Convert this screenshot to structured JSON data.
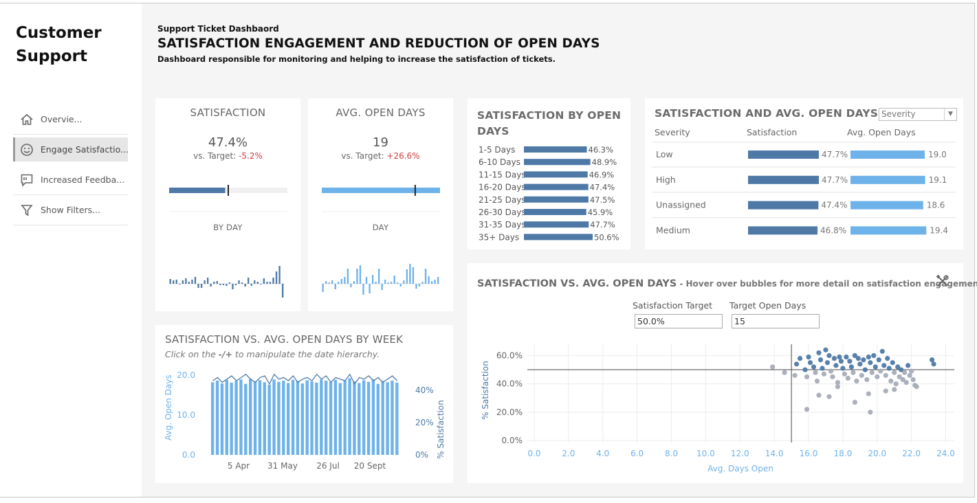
{
  "brand": {
    "line1": "Customer",
    "line2": "Support"
  },
  "nav": [
    {
      "label": "Overvie...",
      "icon": "home-icon"
    },
    {
      "label": "Engage Satisfactio...",
      "icon": "smiley-icon"
    },
    {
      "label": "Increased Feedba...",
      "icon": "feedback-icon"
    },
    {
      "label": "Show Filters...",
      "icon": "filter-icon"
    }
  ],
  "header": {
    "small": "Support Ticket Dashbaord",
    "title": "SATISFACTION ENGAGEMENT AND REDUCTION OF OPEN DAYS",
    "subtitle": "Dashboard responsible for monitoring and helping to increase the satisfaction of tickets."
  },
  "kpi_satisfaction": {
    "title": "SATISFACTION",
    "value": "47.4%",
    "vs_prefix": "vs. Target: ",
    "vs_value": "-5.2%",
    "sub": "BY DAY",
    "bar_fill": 0.474,
    "target_mark": 0.5
  },
  "kpi_open_days": {
    "title": "AVG. OPEN DAYS",
    "value": "19",
    "vs_prefix": "vs. Target: ",
    "vs_value": "+26.6%",
    "sub": "DAY",
    "bar_fill": 1.0,
    "target_mark": 0.79
  },
  "spark_satisfaction": [
    7,
    5,
    6,
    -1,
    5,
    8,
    3,
    6,
    10,
    -6,
    -6,
    5,
    9,
    -4,
    3,
    4,
    -2,
    -2,
    -3,
    2,
    -8,
    -2,
    5,
    2,
    -4,
    9,
    -3,
    5,
    3,
    -1,
    8,
    3,
    3,
    9,
    18,
    26,
    -20
  ],
  "spark_open_days": [
    -12,
    4,
    2,
    5,
    -8,
    3,
    7,
    10,
    22,
    -5,
    4,
    22,
    27,
    -16,
    10,
    -14,
    13,
    3,
    22,
    -9,
    6,
    2,
    3,
    12,
    2,
    -4,
    5,
    21,
    29,
    24,
    -7,
    -4,
    3,
    22,
    11,
    4,
    6,
    10
  ],
  "sat_by_open_days": {
    "title_line1": "SATISFACTION BY OPEN",
    "title_line2": "DAYS",
    "rows": [
      {
        "label": "1-5 Days",
        "value": 46.3,
        "text": "46.3%"
      },
      {
        "label": "6-10 Days",
        "value": 48.9,
        "text": "48.9%"
      },
      {
        "label": "11-15 Days",
        "value": 46.9,
        "text": "46.9%"
      },
      {
        "label": "16-20 Days",
        "value": 47.4,
        "text": "47.4%"
      },
      {
        "label": "21-25 Days",
        "value": 47.5,
        "text": "47.5%"
      },
      {
        "label": "26-30 Days",
        "value": 45.9,
        "text": "45.9%"
      },
      {
        "label": "31-35 Days",
        "value": 47.7,
        "text": "47.7%"
      },
      {
        "label": "35+ Days",
        "value": 50.6,
        "text": "50.6%"
      }
    ]
  },
  "severity": {
    "title": "SATISFACTION AND AVG. OPEN DAYS BY",
    "select_value": "Severity",
    "col_severity": "Severity",
    "col_satisfaction": "Satisfaction",
    "col_open_days": "Avg. Open Days",
    "rows": [
      {
        "label": "Low",
        "sat": 47.7,
        "sat_text": "47.7%",
        "days": 19.0,
        "days_text": "19.0"
      },
      {
        "label": "High",
        "sat": 47.7,
        "sat_text": "47.7%",
        "days": 19.1,
        "days_text": "19.1"
      },
      {
        "label": "Unassigned",
        "sat": 47.4,
        "sat_text": "47.4%",
        "days": 18.6,
        "days_text": "18.6"
      },
      {
        "label": "Medium",
        "sat": 46.8,
        "sat_text": "46.8%",
        "days": 19.4,
        "days_text": "19.4"
      }
    ]
  },
  "weekly": {
    "title": "SATISFACTION VS. AVG. OPEN DAYS BY WEEK",
    "hint_pre": "Click on the ",
    "hint_symbol": "-/+",
    "hint_post": " to manipulate the date hierarchy.",
    "y_left_label": "Avg. Open Days",
    "y_right_label": "% Satisfaction",
    "y_left_ticks": [
      "20.0",
      "10.0",
      "0.0"
    ],
    "y_right_ticks": [
      "40%",
      "20%",
      "0%"
    ],
    "x_ticks": [
      "5 Apr",
      "31 May",
      "26 Jul",
      "20 Sept"
    ]
  },
  "scatter": {
    "title": "SATISFACTION VS. AVG. OPEN DAYS",
    "title_note": " - Hover over bubbles for more detail on satisfaction engagement.",
    "param_sat_label": "Satisfaction Target",
    "param_sat_value": "50.0%",
    "param_days_label": "Target Open Days",
    "param_days_value": "15",
    "y_label": "% Satisfaction",
    "x_label": "Avg. Days Open",
    "y_ticks": [
      "60.0%",
      "40.0%",
      "20.0%",
      "0.0%"
    ],
    "x_ticks": [
      "0.0",
      "2.0",
      "4.0",
      "6.0",
      "8.0",
      "10.0",
      "12.0",
      "14.0",
      "16.0",
      "18.0",
      "20.0",
      "22.0",
      "24.0"
    ],
    "target_sat": 50,
    "target_days": 15
  },
  "colors": {
    "dark_blue": "#4e79a7",
    "light_blue": "#6eb2ea",
    "grey_dot": "#a7acb8",
    "negative": "#d23b3b"
  },
  "chart_data": [
    {
      "type": "bar",
      "title": "SATISFACTION BY OPEN DAYS",
      "categories": [
        "1-5 Days",
        "6-10 Days",
        "11-15 Days",
        "16-20 Days",
        "21-25 Days",
        "26-30 Days",
        "31-35 Days",
        "35+ Days"
      ],
      "values": [
        46.3,
        48.9,
        46.9,
        47.4,
        47.5,
        45.9,
        47.7,
        50.6
      ]
    },
    {
      "type": "bar",
      "title": "SATISFACTION AND AVG. OPEN DAYS BY",
      "categories": [
        "Low",
        "High",
        "Unassigned",
        "Medium"
      ],
      "series": [
        {
          "name": "Satisfaction",
          "values": [
            47.7,
            47.7,
            47.4,
            46.8
          ]
        },
        {
          "name": "Avg. Open Days",
          "values": [
            19.0,
            19.1,
            18.6,
            19.4
          ]
        }
      ]
    },
    {
      "type": "bar",
      "title": "SATISFACTION VS. AVG. OPEN DAYS BY WEEK",
      "xlabel": "",
      "ylabel": "Avg. Open Days",
      "ylim": [
        0,
        21
      ],
      "x_ticks": [
        "5 Apr",
        "31 May",
        "26 Jul",
        "20 Sept"
      ],
      "series": [
        {
          "name": "Avg. Open Days",
          "values": [
            18.2,
            18.6,
            17.9,
            18.8,
            18.1,
            18.5,
            18.9,
            17.8,
            19.0,
            18.4,
            18.7,
            18.2,
            17.6,
            18.9,
            18.3,
            18.6,
            18.0,
            18.8,
            18.5,
            17.9,
            18.7,
            18.4,
            18.1,
            18.9,
            18.6,
            18.2,
            18.8,
            18.0,
            18.6,
            19.2,
            18.4,
            18.0,
            18.7,
            18.3,
            18.9,
            17.8,
            18.5,
            18.2,
            18.6,
            18.1
          ]
        },
        {
          "name": "% Satisfaction",
          "values": [
            46,
            48,
            45,
            47,
            49,
            46,
            48,
            50,
            47,
            45,
            48,
            49,
            44,
            50,
            47,
            48,
            46,
            49,
            45,
            47,
            48,
            46,
            50,
            47,
            49,
            45,
            48,
            47,
            46,
            50,
            44,
            48,
            47,
            49,
            46,
            48,
            45,
            47,
            49,
            46
          ]
        }
      ]
    },
    {
      "type": "scatter",
      "title": "SATISFACTION VS. AVG. OPEN DAYS",
      "xlabel": "Avg. Days Open",
      "ylabel": "% Satisfaction",
      "xlim": [
        0,
        24.5
      ],
      "ylim": [
        0,
        68
      ],
      "reference_lines": {
        "x": 15,
        "y": 50
      },
      "points": [
        [
          13.9,
          52
        ],
        [
          14.6,
          48
        ],
        [
          15.3,
          54
        ],
        [
          15.2,
          46
        ],
        [
          15.5,
          58
        ],
        [
          15.8,
          50
        ],
        [
          15.9,
          45
        ],
        [
          16.0,
          59
        ],
        [
          16.1,
          55
        ],
        [
          16.3,
          52
        ],
        [
          16.4,
          48
        ],
        [
          16.5,
          42
        ],
        [
          16.6,
          62
        ],
        [
          16.7,
          57
        ],
        [
          16.8,
          51
        ],
        [
          16.9,
          47
        ],
        [
          17.0,
          64
        ],
        [
          17.1,
          55
        ],
        [
          17.2,
          60
        ],
        [
          17.3,
          49
        ],
        [
          17.4,
          45
        ],
        [
          17.5,
          58
        ],
        [
          17.6,
          53
        ],
        [
          17.7,
          41
        ],
        [
          17.8,
          59
        ],
        [
          17.9,
          56
        ],
        [
          18.0,
          51
        ],
        [
          18.1,
          47
        ],
        [
          18.2,
          59
        ],
        [
          18.3,
          44
        ],
        [
          18.4,
          56
        ],
        [
          18.5,
          52
        ],
        [
          18.6,
          48
        ],
        [
          18.7,
          60
        ],
        [
          18.8,
          42
        ],
        [
          18.9,
          58
        ],
        [
          19.0,
          54
        ],
        [
          19.1,
          46
        ],
        [
          19.2,
          57
        ],
        [
          19.3,
          50
        ],
        [
          19.4,
          43
        ],
        [
          19.5,
          59
        ],
        [
          19.6,
          55
        ],
        [
          19.7,
          48
        ],
        [
          19.8,
          60
        ],
        [
          19.9,
          52
        ],
        [
          20.0,
          45
        ],
        [
          20.1,
          57
        ],
        [
          20.2,
          49
        ],
        [
          20.3,
          63
        ],
        [
          20.4,
          53
        ],
        [
          20.5,
          46
        ],
        [
          20.6,
          58
        ],
        [
          20.7,
          51
        ],
        [
          20.8,
          42
        ],
        [
          20.9,
          55
        ],
        [
          21.0,
          48
        ],
        [
          21.1,
          40
        ],
        [
          21.2,
          52
        ],
        [
          21.3,
          45
        ],
        [
          21.4,
          50
        ],
        [
          21.5,
          43
        ],
        [
          21.6,
          48
        ],
        [
          21.7,
          41
        ],
        [
          21.8,
          53
        ],
        [
          21.9,
          46
        ],
        [
          22.0,
          49
        ],
        [
          22.1,
          43
        ],
        [
          22.2,
          39
        ],
        [
          23.2,
          57
        ],
        [
          23.3,
          54
        ],
        [
          16.6,
          32
        ],
        [
          15.9,
          22
        ],
        [
          17.2,
          31
        ],
        [
          19.5,
          33
        ],
        [
          18.7,
          27
        ],
        [
          20.5,
          35
        ],
        [
          22.3,
          38
        ],
        [
          19.6,
          20
        ],
        [
          17.7,
          38
        ],
        [
          21.0,
          36
        ]
      ]
    }
  ]
}
